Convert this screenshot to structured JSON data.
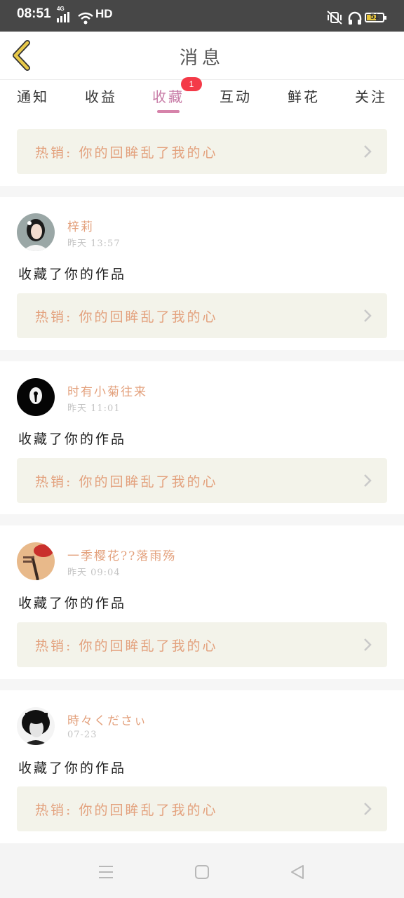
{
  "status_bar": {
    "time": "08:51",
    "network": "4G",
    "hd": "HD",
    "battery": "51"
  },
  "header": {
    "title": "消息",
    "back_icon": "chevron-left-icon"
  },
  "tabs": [
    {
      "label": "通知"
    },
    {
      "label": "收益"
    },
    {
      "label": "收藏",
      "active": true,
      "badge": "1"
    },
    {
      "label": "互动"
    },
    {
      "label": "鲜花"
    },
    {
      "label": "关注"
    }
  ],
  "top_promo": {
    "text": "热销: 你的回眸乱了我的心"
  },
  "items": [
    {
      "name": "梓莉",
      "time": "昨天 13:57",
      "action": "收藏了你的作品",
      "promo": "热销: 你的回眸乱了我的心"
    },
    {
      "name": "时有小菊往来",
      "time": "昨天 11:01",
      "action": "收藏了你的作品",
      "promo": "热销: 你的回眸乱了我的心"
    },
    {
      "name": "一季樱花??落雨殇",
      "time": "昨天 09:04",
      "action": "收藏了你的作品",
      "promo": "热销: 你的回眸乱了我的心"
    },
    {
      "name": "時々くださぃ",
      "time": "07-23",
      "action": "收藏了你的作品",
      "promo": "热销: 你的回眸乱了我的心"
    }
  ],
  "colors": {
    "accent": "#d683aa",
    "badge": "#f43a48",
    "promo_text": "#e3a17d",
    "promo_bg": "#f3f3ea",
    "back_arrow": "#e8c94a"
  }
}
